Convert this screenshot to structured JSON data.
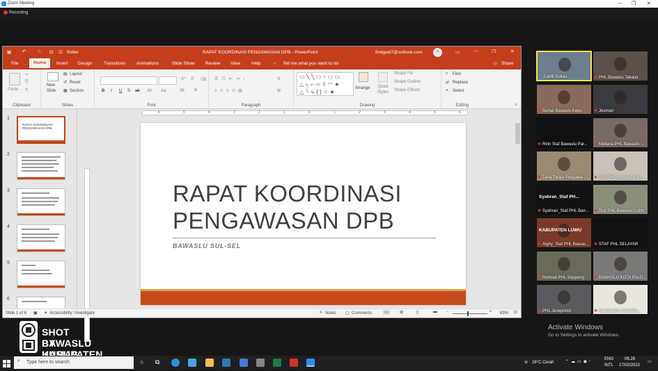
{
  "zoom": {
    "window_title": "Zoom Meeting",
    "recording": "Recording",
    "win_controls": [
      "—",
      "❐",
      "✕"
    ]
  },
  "ppt": {
    "title": "RAPAT KOORDINASI PENGAWASAN DPB  -  PowerPoint",
    "account": "findgsid7@outlook.com",
    "autosave_label": "Roller",
    "share": "Share",
    "tell_me": "Tell me what you want to do",
    "tabs": [
      "File",
      "Home",
      "Insert",
      "Design",
      "Transitions",
      "Animations",
      "Slide Show",
      "Review",
      "View",
      "Help"
    ],
    "ribbon": {
      "paste": "Paste",
      "new_slide": "New Slide",
      "layout": "Layout",
      "reset": "Reset",
      "section": "Section",
      "arrange": "Arrange",
      "quick_styles": "Quick Styles",
      "shape_fill": "Shape Fill",
      "shape_outline": "Shape Outline",
      "shape_effects": "Shape Effects",
      "find": "Find",
      "replace": "Replace",
      "select": "Select",
      "groups": [
        "Clipboard",
        "Slides",
        "Font",
        "Paragraph",
        "Drawing",
        "Editing"
      ]
    },
    "slide": {
      "title_line1": "RAPAT KOORDINASI",
      "title_line2": "PENGAWASAN DPB",
      "subtitle": "BAWASLU SUL-SEL"
    },
    "thumb_numbers": [
      "1",
      "2",
      "3",
      "4",
      "5",
      "6"
    ],
    "thumb1_text": "RAPAT KOORDINASI PENGAWASAN DPB",
    "status": {
      "slide_of": "Slide 1 of 6",
      "accessibility": "Accessibility: Investigate",
      "notes": "Notes",
      "comments": "Comments",
      "zoom": "63%"
    }
  },
  "participants": [
    {
      "name": "Zulkfli Sultan",
      "active": true,
      "bg": "#6d7f8e"
    },
    {
      "name": "PHL Bawaslu Takalar",
      "bg": "#5c5048"
    },
    {
      "name": "Suhail Bawaslu Kepu",
      "bg": "#8a6a5a"
    },
    {
      "name": "Jesmari",
      "bg": "#3b3a40"
    },
    {
      "name": "Ririn Staf Bawaslu Par...",
      "bg": "#111111"
    },
    {
      "name": "Meliana PHL Bawaslu ...",
      "bg": "#7a6a66"
    },
    {
      "name": "Tana Toraja Pengawa...",
      "bg": "#9a8a72"
    },
    {
      "name": "Staf PHL Bawaslu Kab...",
      "bg": "#c9c2b8"
    },
    {
      "name": "Syahran_Staf PHL Ban...",
      "bg": "#111111",
      "label": "Syahran_Staf  PH..."
    },
    {
      "name": "Staf PHL Bawaslu Lutim",
      "bg": "#8a8f7a"
    },
    {
      "name": "Alghy_Staf PHL Bawas...",
      "bg": "#7a3a2a",
      "label": "KABUPATEN LUWU"
    },
    {
      "name": "STAF PHL SELAYAR",
      "bg": "#111111"
    },
    {
      "name": "Rahmat PHL Soppeng",
      "bg": "#6b6a5a"
    },
    {
      "name": "BAWASLU KOTA PALO...",
      "bg": "#7a7a78"
    },
    {
      "name": "PHL Jeneponto",
      "bg": "#5a5a60"
    },
    {
      "name": "Syahbuddin (Staf Ba...",
      "bg": "#e9e6de"
    }
  ],
  "watermark": {
    "line1": "SHOT BY HUMAS",
    "line2": "BAWASLU KABUPATEN TAKALAR"
  },
  "activate": {
    "title": "Activate Windows",
    "sub": "Go to Settings to activate Windows."
  },
  "taskbar": {
    "search_placeholder": "Type here to search",
    "weather": "28°C  Cerah",
    "lang1": "ENG",
    "lang2": "INTL",
    "time": "08.28",
    "date": "17/02/2022"
  }
}
